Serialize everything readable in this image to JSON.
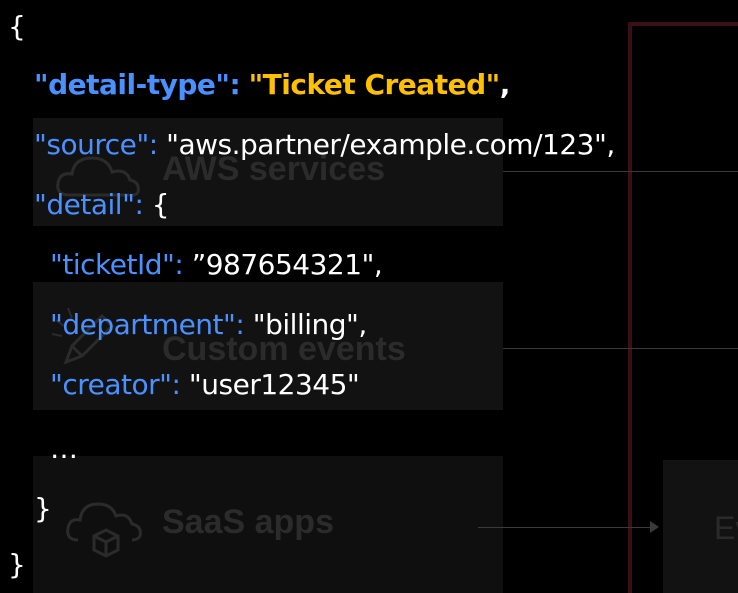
{
  "sources": {
    "aws": {
      "label": "AWS services",
      "icon": "cloud-icon"
    },
    "custom": {
      "label": "Custom events",
      "icon": "pencil-icon"
    },
    "saas": {
      "label": "SaaS apps",
      "icon": "cloud-box-icon"
    }
  },
  "target": {
    "label": "Ev"
  },
  "event_json": {
    "open_brace": "{",
    "detail_type_key": "\"detail-type\":",
    "detail_type_value": "\"Ticket Created\"",
    "source_key": "\"source\":",
    "source_value": "\"aws.partner/example.com/123\",",
    "detail_key": "\"detail\":",
    "detail_open": "{",
    "ticket_key": "\"ticketId\":",
    "ticket_value": "”987654321\",",
    "department_key": "\"department\":",
    "department_value": "\"billing\",",
    "creator_key": "\"creator\":",
    "creator_value": "\"user12345\"",
    "ellipsis": "…",
    "detail_close": "}",
    "close_brace": "}",
    "comma": ","
  },
  "colors": {
    "background": "#000000",
    "key": "#4a90ff",
    "highlight_value": "#ffc000",
    "text": "#ffffff",
    "bus_frame": "#3a1016"
  }
}
